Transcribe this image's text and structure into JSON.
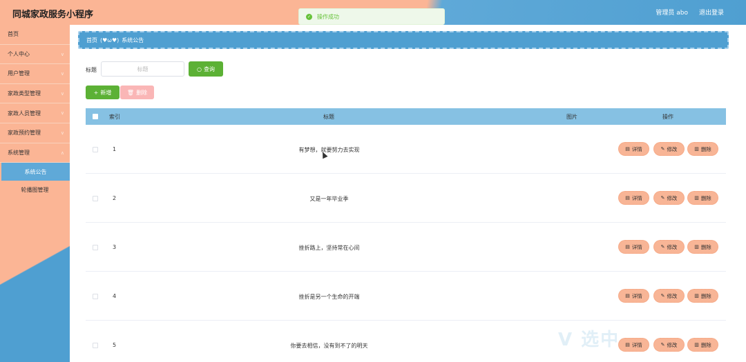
{
  "header": {
    "title": "同城家政服务小程序",
    "user": "管理员 abo",
    "logout": "退出登录"
  },
  "toast": {
    "text": "操作成功"
  },
  "sidebar": {
    "items": [
      {
        "label": "首页"
      },
      {
        "label": "个人中心"
      },
      {
        "label": "用户管理"
      },
      {
        "label": "家政类型管理"
      },
      {
        "label": "家政人员管理"
      },
      {
        "label": "家政预约管理"
      },
      {
        "label": "系统管理"
      }
    ],
    "sub_items": [
      {
        "label": "系统公告",
        "active": true
      },
      {
        "label": "轮播图管理",
        "active": false
      }
    ]
  },
  "breadcrumb": {
    "home": "首页",
    "sep": "(♥ω♥)",
    "current": "系统公告"
  },
  "search": {
    "label": "标题",
    "placeholder": "标题",
    "query_label": "查询"
  },
  "actions": {
    "add_label": "新增",
    "delete_label": "删除"
  },
  "table": {
    "columns": {
      "index": "索引",
      "title": "标题",
      "image": "图片",
      "ops": "操作"
    },
    "rows": [
      {
        "index": "1",
        "title": "有梦想，就要努力去实现"
      },
      {
        "index": "2",
        "title": "又是一年毕业季"
      },
      {
        "index": "3",
        "title": "挫折路上，坚持常在心间"
      },
      {
        "index": "4",
        "title": "挫折是另一个生命的开端"
      },
      {
        "index": "5",
        "title": "你要去相信，没有到不了的明天"
      }
    ],
    "ops": {
      "detail": "详情",
      "edit": "修改",
      "remove": "删除"
    }
  },
  "watermark": {
    "text": "V 选中"
  },
  "colors": {
    "peach": "#fbb595",
    "blue": "#4f9fd1",
    "green": "#5cb135",
    "light_blue_header": "#86c1e3",
    "pink_disabled": "#fab6b6"
  }
}
